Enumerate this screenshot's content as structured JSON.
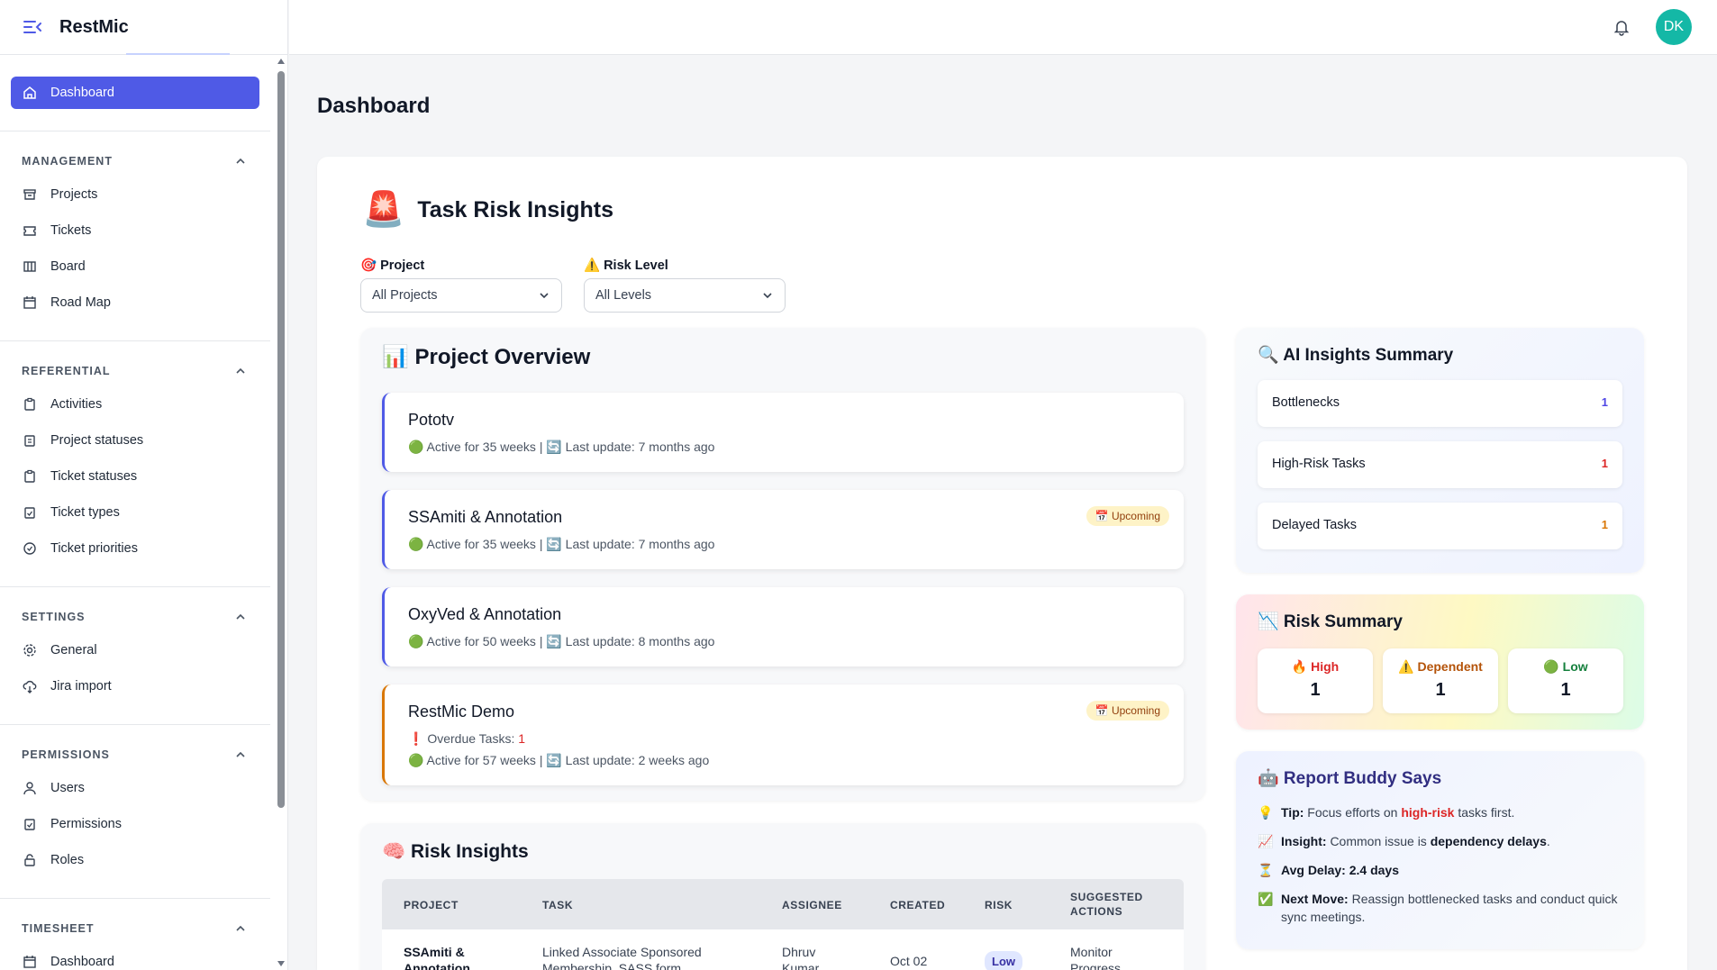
{
  "app": {
    "title": "RestMic"
  },
  "topbar": {
    "avatar_initials": "DK"
  },
  "sidebar": {
    "dashboard": "Dashboard",
    "sections": [
      {
        "title": "MANAGEMENT",
        "items": [
          "Projects",
          "Tickets",
          "Board",
          "Road Map"
        ]
      },
      {
        "title": "REFERENTIAL",
        "items": [
          "Activities",
          "Project statuses",
          "Ticket statuses",
          "Ticket types",
          "Ticket priorities"
        ]
      },
      {
        "title": "SETTINGS",
        "items": [
          "General",
          "Jira import"
        ]
      },
      {
        "title": "PERMISSIONS",
        "items": [
          "Users",
          "Permissions",
          "Roles"
        ]
      },
      {
        "title": "TIMESHEET",
        "items": [
          "Dashboard"
        ]
      }
    ]
  },
  "page": {
    "title": "Dashboard"
  },
  "insights": {
    "title": "Task Risk Insights",
    "project_filter": {
      "label": "🎯 Project",
      "value": "All Projects"
    },
    "risk_filter": {
      "label": "⚠️ Risk Level",
      "value": "All Levels"
    }
  },
  "overview": {
    "title": "📊 Project Overview",
    "projects": [
      {
        "name": "Pototv",
        "meta": "🟢 Active for 35 weeks | 🔄 Last update: 7 months ago",
        "badge": ""
      },
      {
        "name": "SSAmiti & Annotation",
        "meta": "🟢 Active for 35 weeks | 🔄 Last update: 7 months ago",
        "badge": "📅 Upcoming"
      },
      {
        "name": "OxyVed & Annotation",
        "meta": "🟢 Active for 50 weeks | 🔄 Last update: 8 months ago",
        "badge": ""
      },
      {
        "name": "RestMic Demo",
        "overdue_label": "❗ Overdue Tasks:",
        "overdue_count": "1",
        "meta": "🟢 Active for 57 weeks | 🔄 Last update: 2 weeks ago",
        "badge": "📅 Upcoming"
      }
    ]
  },
  "risk_insights": {
    "title": "🧠 Risk Insights",
    "columns": [
      "PROJECT",
      "TASK",
      "ASSIGNEE",
      "CREATED",
      "RISK",
      "SUGGESTED ACTIONS"
    ],
    "rows": [
      {
        "project": "SSAmiti & Annotation",
        "task": "Linked Associate Sponsored Membership, SASS form",
        "assignee": "Dhruv Kumar",
        "created": "Oct 02",
        "risk": "Low",
        "action": "Monitor Progress"
      }
    ]
  },
  "ai_summary": {
    "title": "🔍 AI Insights Summary",
    "metrics": [
      {
        "label": "Bottlenecks",
        "value": "1",
        "color": "#4f46e5"
      },
      {
        "label": "High-Risk Tasks",
        "value": "1",
        "color": "#dc2626"
      },
      {
        "label": "Delayed Tasks",
        "value": "1",
        "color": "#d97706"
      }
    ]
  },
  "risk_summary": {
    "title": "📉 Risk Summary",
    "items": [
      {
        "label": "🔥 High",
        "value": "1",
        "color": "#dc2626"
      },
      {
        "label": "⚠️ Dependent",
        "value": "1",
        "color": "#b45309"
      },
      {
        "label": "🟢 Low",
        "value": "1",
        "color": "#15803d"
      }
    ]
  },
  "buddy": {
    "title": "🤖 Report Buddy Says",
    "tip": {
      "emoji": "💡",
      "label": "Tip:",
      "pre": "Focus efforts on",
      "highlight": "high-risk",
      "post": "tasks first."
    },
    "insight": {
      "emoji": "📈",
      "label": "Insight:",
      "pre": "Common issue is",
      "strong": "dependency delays",
      "post": "."
    },
    "delay": {
      "emoji": "⏳",
      "label": "Avg Delay:",
      "value": "2.4 days"
    },
    "next": {
      "emoji": "✅",
      "label": "Next Move:",
      "text": "Reassign bottlenecked tasks and conduct quick sync meetings."
    }
  }
}
